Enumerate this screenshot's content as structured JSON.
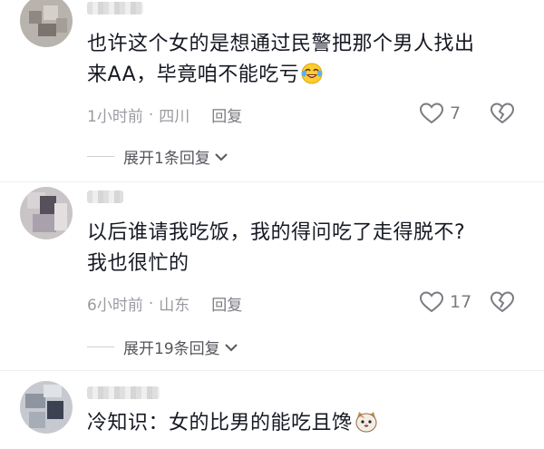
{
  "comments": [
    {
      "text_line1": "也许这个女的是想通过民警把那个男人找出",
      "text_line2": "来AA，毕竟咱不能吃亏",
      "emoji": "laughing-crying-emoji",
      "time": "1小时前",
      "separator": "·",
      "location": "四川",
      "reply_label": "回复",
      "likes": "7",
      "expand_label": "展开1条回复"
    },
    {
      "text_line1": "以后谁请我吃饭，我的得问吃了走得脱不?",
      "text_line2": "我也很忙的",
      "time": "6小时前",
      "separator": "·",
      "location": "山东",
      "reply_label": "回复",
      "likes": "17",
      "expand_label": "展开19条回复"
    },
    {
      "text_line1": "冷知识：女的比男的能吃且馋",
      "emoji": "cat-emoji"
    }
  ],
  "colors": {
    "text": "#161823",
    "meta": "#9a9ba1",
    "icon": "#7b7c82"
  }
}
